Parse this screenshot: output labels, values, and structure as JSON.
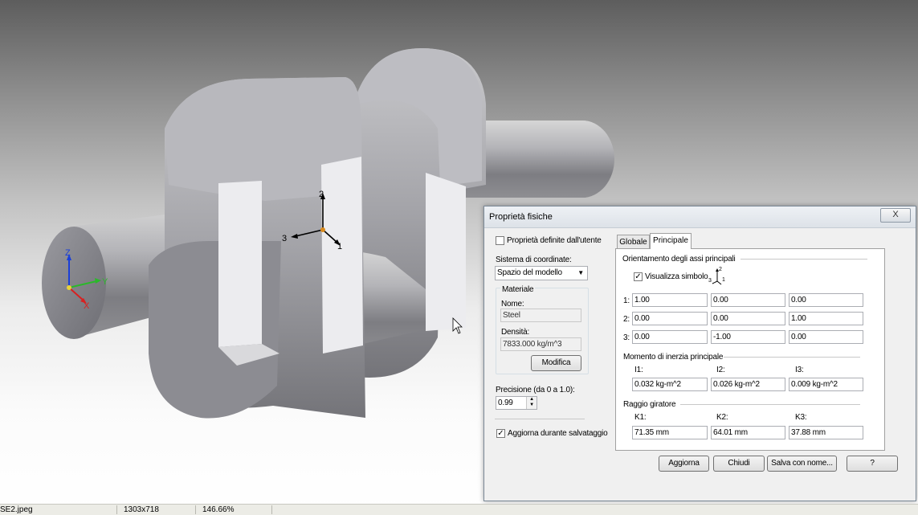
{
  "viewport": {
    "axis_labels": {
      "z": "Z",
      "y": "Y",
      "x": "X"
    },
    "principal_axes": {
      "a1": "1",
      "a2": "2",
      "a3": "3"
    }
  },
  "dialog": {
    "title": "Proprietà fisiche",
    "close": "X",
    "user_defined_label": "Proprietà definite dall'utente",
    "coord_system_label": "Sistema di coordinate:",
    "coord_system_value": "Spazio del modello",
    "material_group": "Materiale",
    "name_label": "Nome:",
    "name_value": "Steel",
    "density_label": "Densità:",
    "density_value": "7833.000 kg/m^3",
    "modify_button": "Modifica",
    "precision_label": "Precisione (da 0 a 1.0):",
    "precision_value": "0.99",
    "update_on_save_label": "Aggiorna durante salvataggio",
    "update_on_save_checked": "✓",
    "tabs": {
      "global": "Globale",
      "principal": "Principale"
    },
    "principal": {
      "orientation_title": "Orientamento degli assi principali",
      "show_symbol_label": "Visualizza simbolo",
      "show_symbol_checked": "✓",
      "rows": [
        {
          "label": "1:",
          "v": [
            "1.00",
            "0.00",
            "0.00"
          ]
        },
        {
          "label": "2:",
          "v": [
            "0.00",
            "0.00",
            "1.00"
          ]
        },
        {
          "label": "3:",
          "v": [
            "0.00",
            "-1.00",
            "0.00"
          ]
        }
      ],
      "moment_title": "Momento di inerzia principale",
      "moments": [
        {
          "label": "I1:",
          "value": "0.032 kg-m^2"
        },
        {
          "label": "I2:",
          "value": "0.026 kg-m^2"
        },
        {
          "label": "I3:",
          "value": "0.009 kg-m^2"
        }
      ],
      "gyration_title": "Raggio giratore",
      "gyration": [
        {
          "label": "K1:",
          "value": "71.35 mm"
        },
        {
          "label": "K2:",
          "value": "64.01 mm"
        },
        {
          "label": "K3:",
          "value": "37.88 mm"
        }
      ]
    },
    "buttons": {
      "update": "Aggiorna",
      "close": "Chiudi",
      "save_as": "Salva con nome...",
      "help": "?"
    }
  },
  "statusbar": {
    "filename": "SE2.jpeg",
    "dimensions": "1303x718",
    "zoom": "146.66%"
  }
}
